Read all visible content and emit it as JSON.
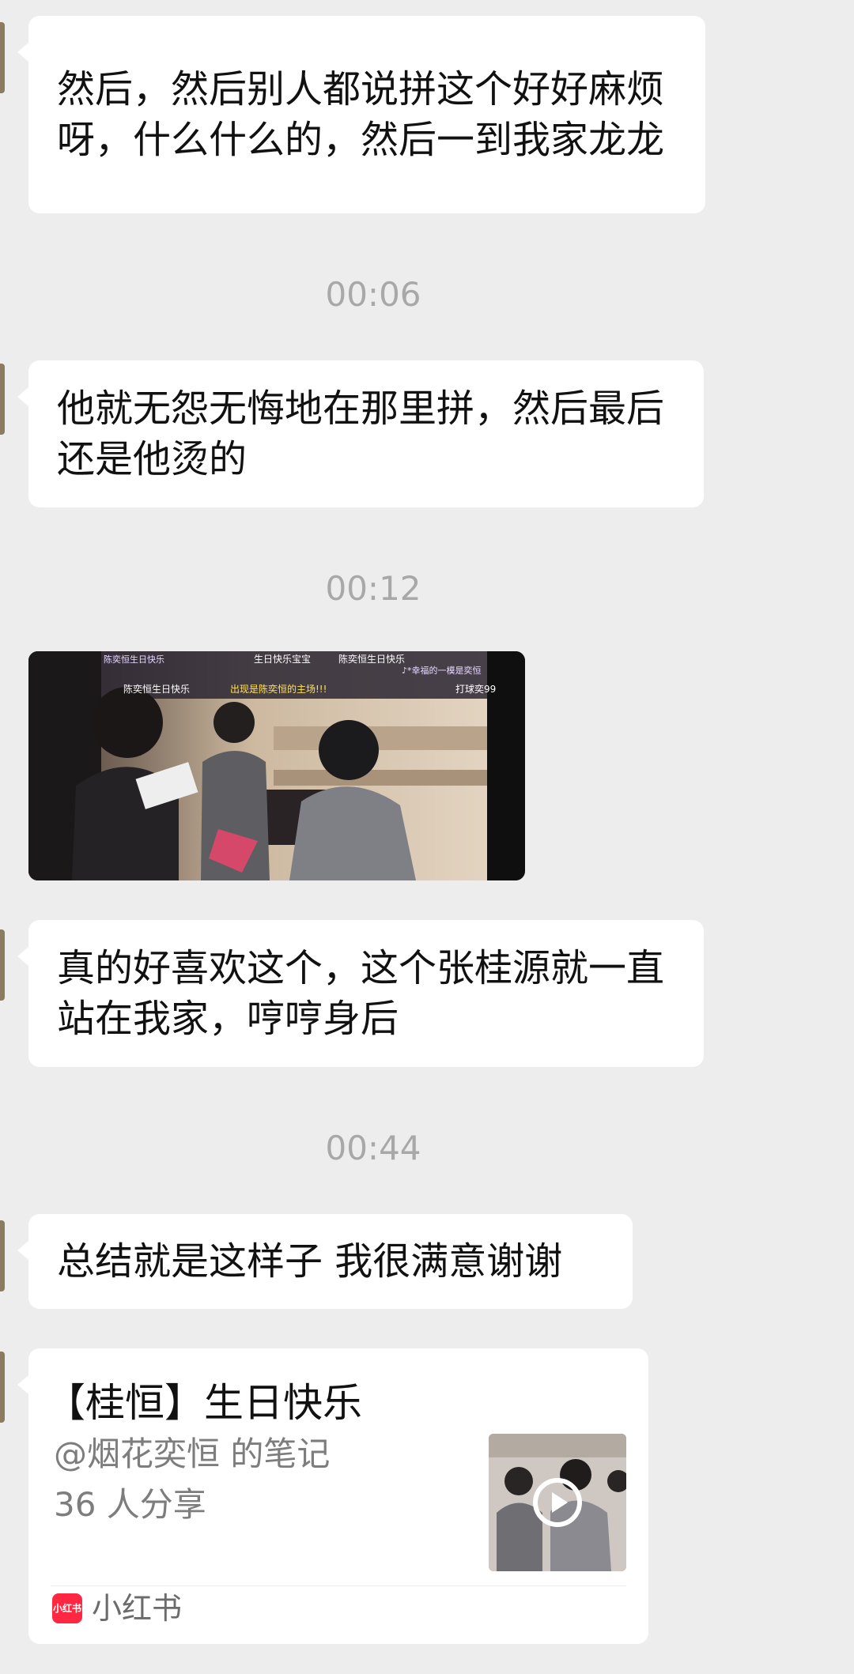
{
  "messages": [
    {
      "text": "然后，然后别人都说拼这个好好麻烦呀，什么什么的，然后一到我家龙龙"
    },
    {
      "text": "他就无怨无悔地在那里拼，然后最后还是他烫的"
    },
    {
      "text": "真的好喜欢这个，这个张桂源就一直站在我家，哼哼身后"
    },
    {
      "text": "总结就是这样子 我很满意谢谢"
    }
  ],
  "timestamps": [
    "00:06",
    "00:12",
    "00:44"
  ],
  "video": {
    "danmaku": [
      "陈奕恒生日快乐",
      "生日快乐宝宝",
      "陈奕恒生日快乐",
      "♪*幸福的一模是奕恒",
      "陈奕恒生日快乐",
      "出现是陈奕恒的主场!!!",
      "打球奕99"
    ]
  },
  "share": {
    "title": "【桂恒】生日快乐",
    "author": "@烟花奕恒 的笔记",
    "count": "36 人分享",
    "source_name": "小红书",
    "source_logo_text": "小红书"
  },
  "colors": {
    "background": "#ededed",
    "bubble": "#ffffff",
    "timestamp": "#a8a8a8",
    "source_brand": "#ff2741"
  }
}
